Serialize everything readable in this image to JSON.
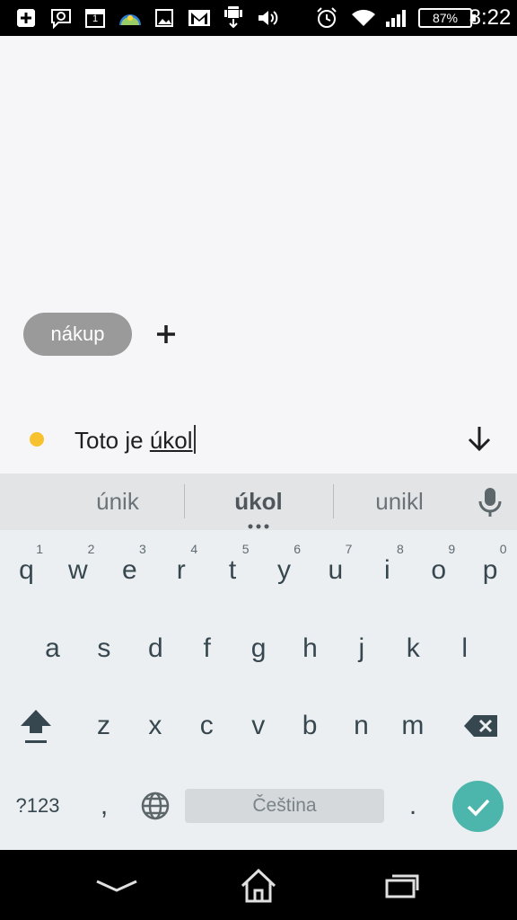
{
  "status_bar": {
    "icons": [
      "plus-box-icon",
      "chat-icon",
      "calendar-icon",
      "weather-icon",
      "image-icon",
      "gmail-icon",
      "android-download-icon",
      "volume-icon",
      "alarm-icon",
      "wifi-icon",
      "signal-icon"
    ],
    "calendar_day": "1",
    "battery": "87%",
    "time": "8:22"
  },
  "app": {
    "tag_label": "nákup",
    "add_tag_icon": "plus-icon",
    "task": {
      "dot_color": "#f7c22d",
      "text_prefix": "Toto je ",
      "text_composing": "úkol"
    },
    "collapse_icon": "arrow-down-icon"
  },
  "suggestions": {
    "left": "únik",
    "center": "úkol",
    "right": "unikl"
  },
  "keyboard": {
    "row1": [
      {
        "ch": "q",
        "hint": "1"
      },
      {
        "ch": "w",
        "hint": "2"
      },
      {
        "ch": "e",
        "hint": "3"
      },
      {
        "ch": "r",
        "hint": "4"
      },
      {
        "ch": "t",
        "hint": "5"
      },
      {
        "ch": "y",
        "hint": "6"
      },
      {
        "ch": "u",
        "hint": "7"
      },
      {
        "ch": "i",
        "hint": "8"
      },
      {
        "ch": "o",
        "hint": "9"
      },
      {
        "ch": "p",
        "hint": "0"
      }
    ],
    "row2": [
      "a",
      "s",
      "d",
      "f",
      "g",
      "h",
      "j",
      "k",
      "l"
    ],
    "row3": [
      "z",
      "x",
      "c",
      "v",
      "b",
      "n",
      "m"
    ],
    "symbols_label": "?123",
    "comma": ",",
    "period": ".",
    "space_label": "Čeština",
    "accent_color": "#4db6ac"
  },
  "navbar": {
    "icons": [
      "back-icon",
      "home-icon",
      "recents-icon"
    ]
  }
}
